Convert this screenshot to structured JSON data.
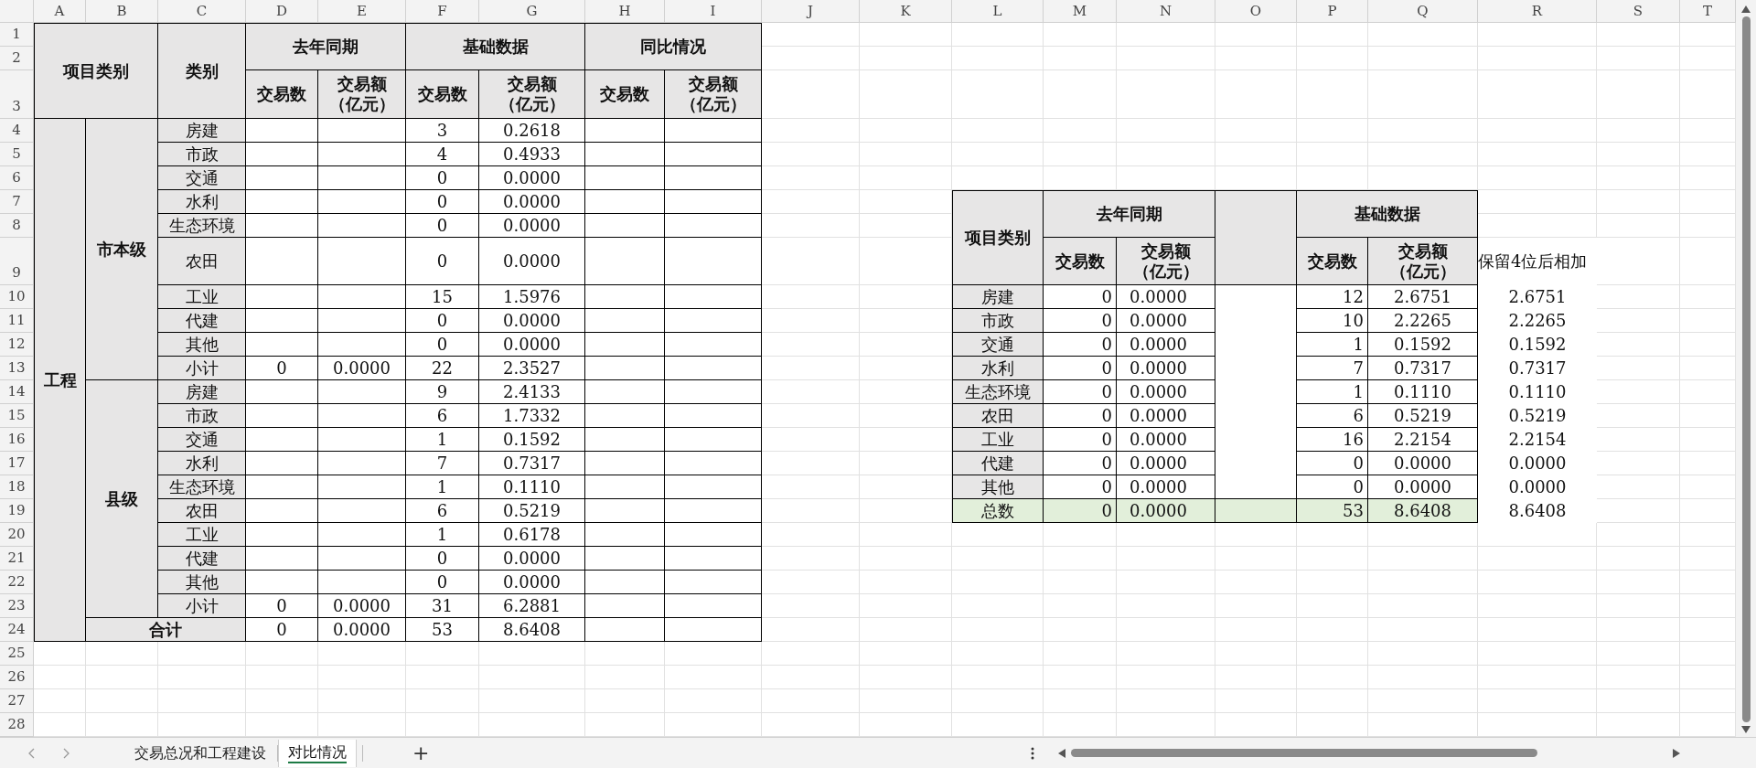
{
  "column_headers": [
    "A",
    "B",
    "C",
    "D",
    "E",
    "F",
    "G",
    "H",
    "I",
    "J",
    "K",
    "L",
    "M",
    "N",
    "O",
    "P",
    "Q",
    "R",
    "S",
    "T"
  ],
  "row_headers": [
    "1",
    "2",
    "3",
    "4",
    "5",
    "6",
    "7",
    "8",
    "9",
    "10",
    "11",
    "12",
    "13",
    "14",
    "15",
    "16",
    "17",
    "18",
    "19",
    "20",
    "21",
    "22",
    "23",
    "24",
    "25",
    "26",
    "27",
    "28"
  ],
  "left_table": {
    "header": {
      "project_category": "项目类别",
      "category": "类别",
      "groups": [
        {
          "title": "去年同期",
          "columns": [
            {
              "label": "交易数"
            },
            {
              "label": "交易额",
              "unit": "（亿元）"
            }
          ]
        },
        {
          "title": "基础数据",
          "columns": [
            {
              "label": "交易数"
            },
            {
              "label": "交易额",
              "unit": "（亿元）"
            }
          ]
        },
        {
          "title": "同比情况",
          "columns": [
            {
              "label": "交易数"
            },
            {
              "label": "交易额",
              "unit": "（亿元）"
            }
          ]
        }
      ]
    },
    "sections": [
      {
        "label": "工程",
        "subgroups": [
          {
            "label": "市本级",
            "rows": [
              {
                "category": "房建",
                "base_count": "3",
                "base_amount": "0.2618"
              },
              {
                "category": "市政",
                "base_count": "4",
                "base_amount": "0.4933"
              },
              {
                "category": "交通",
                "base_count": "0",
                "base_amount": "0.0000"
              },
              {
                "category": "水利",
                "base_count": "0",
                "base_amount": "0.0000"
              },
              {
                "category": "生态环境",
                "base_count": "0",
                "base_amount": "0.0000"
              },
              {
                "category": "农田",
                "base_count": "0",
                "base_amount": "0.0000"
              },
              {
                "category": "工业",
                "base_count": "15",
                "base_amount": "1.5976"
              },
              {
                "category": "代建",
                "base_count": "0",
                "base_amount": "0.0000"
              },
              {
                "category": "其他",
                "base_count": "0",
                "base_amount": "0.0000"
              },
              {
                "category": "小计",
                "last_year_count": "0",
                "last_year_amount": "0.0000",
                "base_count": "22",
                "base_amount": "2.3527"
              }
            ]
          },
          {
            "label": "县级",
            "rows": [
              {
                "category": "房建",
                "base_count": "9",
                "base_amount": "2.4133"
              },
              {
                "category": "市政",
                "base_count": "6",
                "base_amount": "1.7332"
              },
              {
                "category": "交通",
                "base_count": "1",
                "base_amount": "0.1592"
              },
              {
                "category": "水利",
                "base_count": "7",
                "base_amount": "0.7317"
              },
              {
                "category": "生态环境",
                "base_count": "1",
                "base_amount": "0.1110"
              },
              {
                "category": "农田",
                "base_count": "6",
                "base_amount": "0.5219"
              },
              {
                "category": "工业",
                "base_count": "1",
                "base_amount": "0.6178"
              },
              {
                "category": "代建",
                "base_count": "0",
                "base_amount": "0.0000"
              },
              {
                "category": "其他",
                "base_count": "0",
                "base_amount": "0.0000"
              },
              {
                "category": "小计",
                "last_year_count": "0",
                "last_year_amount": "0.0000",
                "base_count": "31",
                "base_amount": "6.2881"
              }
            ]
          }
        ]
      }
    ],
    "total": {
      "label": "合计",
      "last_year_count": "0",
      "last_year_amount": "0.0000",
      "base_count": "53",
      "base_amount": "8.6408"
    }
  },
  "right_table": {
    "header": {
      "project_category": "项目类别",
      "groups": [
        {
          "title": "去年同期",
          "columns": [
            {
              "label": "交易数"
            },
            {
              "label": "交易额",
              "unit": "（亿元）"
            }
          ]
        },
        {
          "title": "基础数据",
          "columns": [
            {
              "label": "交易数"
            },
            {
              "label": "交易额",
              "unit": "（亿元）"
            }
          ]
        }
      ]
    },
    "note": "保留4位后相加",
    "rows": [
      {
        "category": "房建",
        "last_year_count": "0",
        "last_year_amount": "0.0000",
        "base_count": "12",
        "base_amount": "2.6751",
        "rounded_sum": "2.6751"
      },
      {
        "category": "市政",
        "last_year_count": "0",
        "last_year_amount": "0.0000",
        "base_count": "10",
        "base_amount": "2.2265",
        "rounded_sum": "2.2265"
      },
      {
        "category": "交通",
        "last_year_count": "0",
        "last_year_amount": "0.0000",
        "base_count": "1",
        "base_amount": "0.1592",
        "rounded_sum": "0.1592"
      },
      {
        "category": "水利",
        "last_year_count": "0",
        "last_year_amount": "0.0000",
        "base_count": "7",
        "base_amount": "0.7317",
        "rounded_sum": "0.7317"
      },
      {
        "category": "生态环境",
        "last_year_count": "0",
        "last_year_amount": "0.0000",
        "base_count": "1",
        "base_amount": "0.1110",
        "rounded_sum": "0.1110"
      },
      {
        "category": "农田",
        "last_year_count": "0",
        "last_year_amount": "0.0000",
        "base_count": "6",
        "base_amount": "0.5219",
        "rounded_sum": "0.5219"
      },
      {
        "category": "工业",
        "last_year_count": "0",
        "last_year_amount": "0.0000",
        "base_count": "16",
        "base_amount": "2.2154",
        "rounded_sum": "2.2154"
      },
      {
        "category": "代建",
        "last_year_count": "0",
        "last_year_amount": "0.0000",
        "base_count": "0",
        "base_amount": "0.0000",
        "rounded_sum": "0.0000"
      },
      {
        "category": "其他",
        "last_year_count": "0",
        "last_year_amount": "0.0000",
        "base_count": "0",
        "base_amount": "0.0000",
        "rounded_sum": "0.0000"
      }
    ],
    "total": {
      "category": "总数",
      "last_year_count": "0",
      "last_year_amount": "0.0000",
      "base_count": "53",
      "base_amount": "8.6408",
      "rounded_sum": "8.6408"
    }
  },
  "sheet_tabs": [
    {
      "label": "交易总况和工程建设",
      "selected": false
    },
    {
      "label": "对比情况",
      "selected": true
    }
  ],
  "add_sheet": "+"
}
